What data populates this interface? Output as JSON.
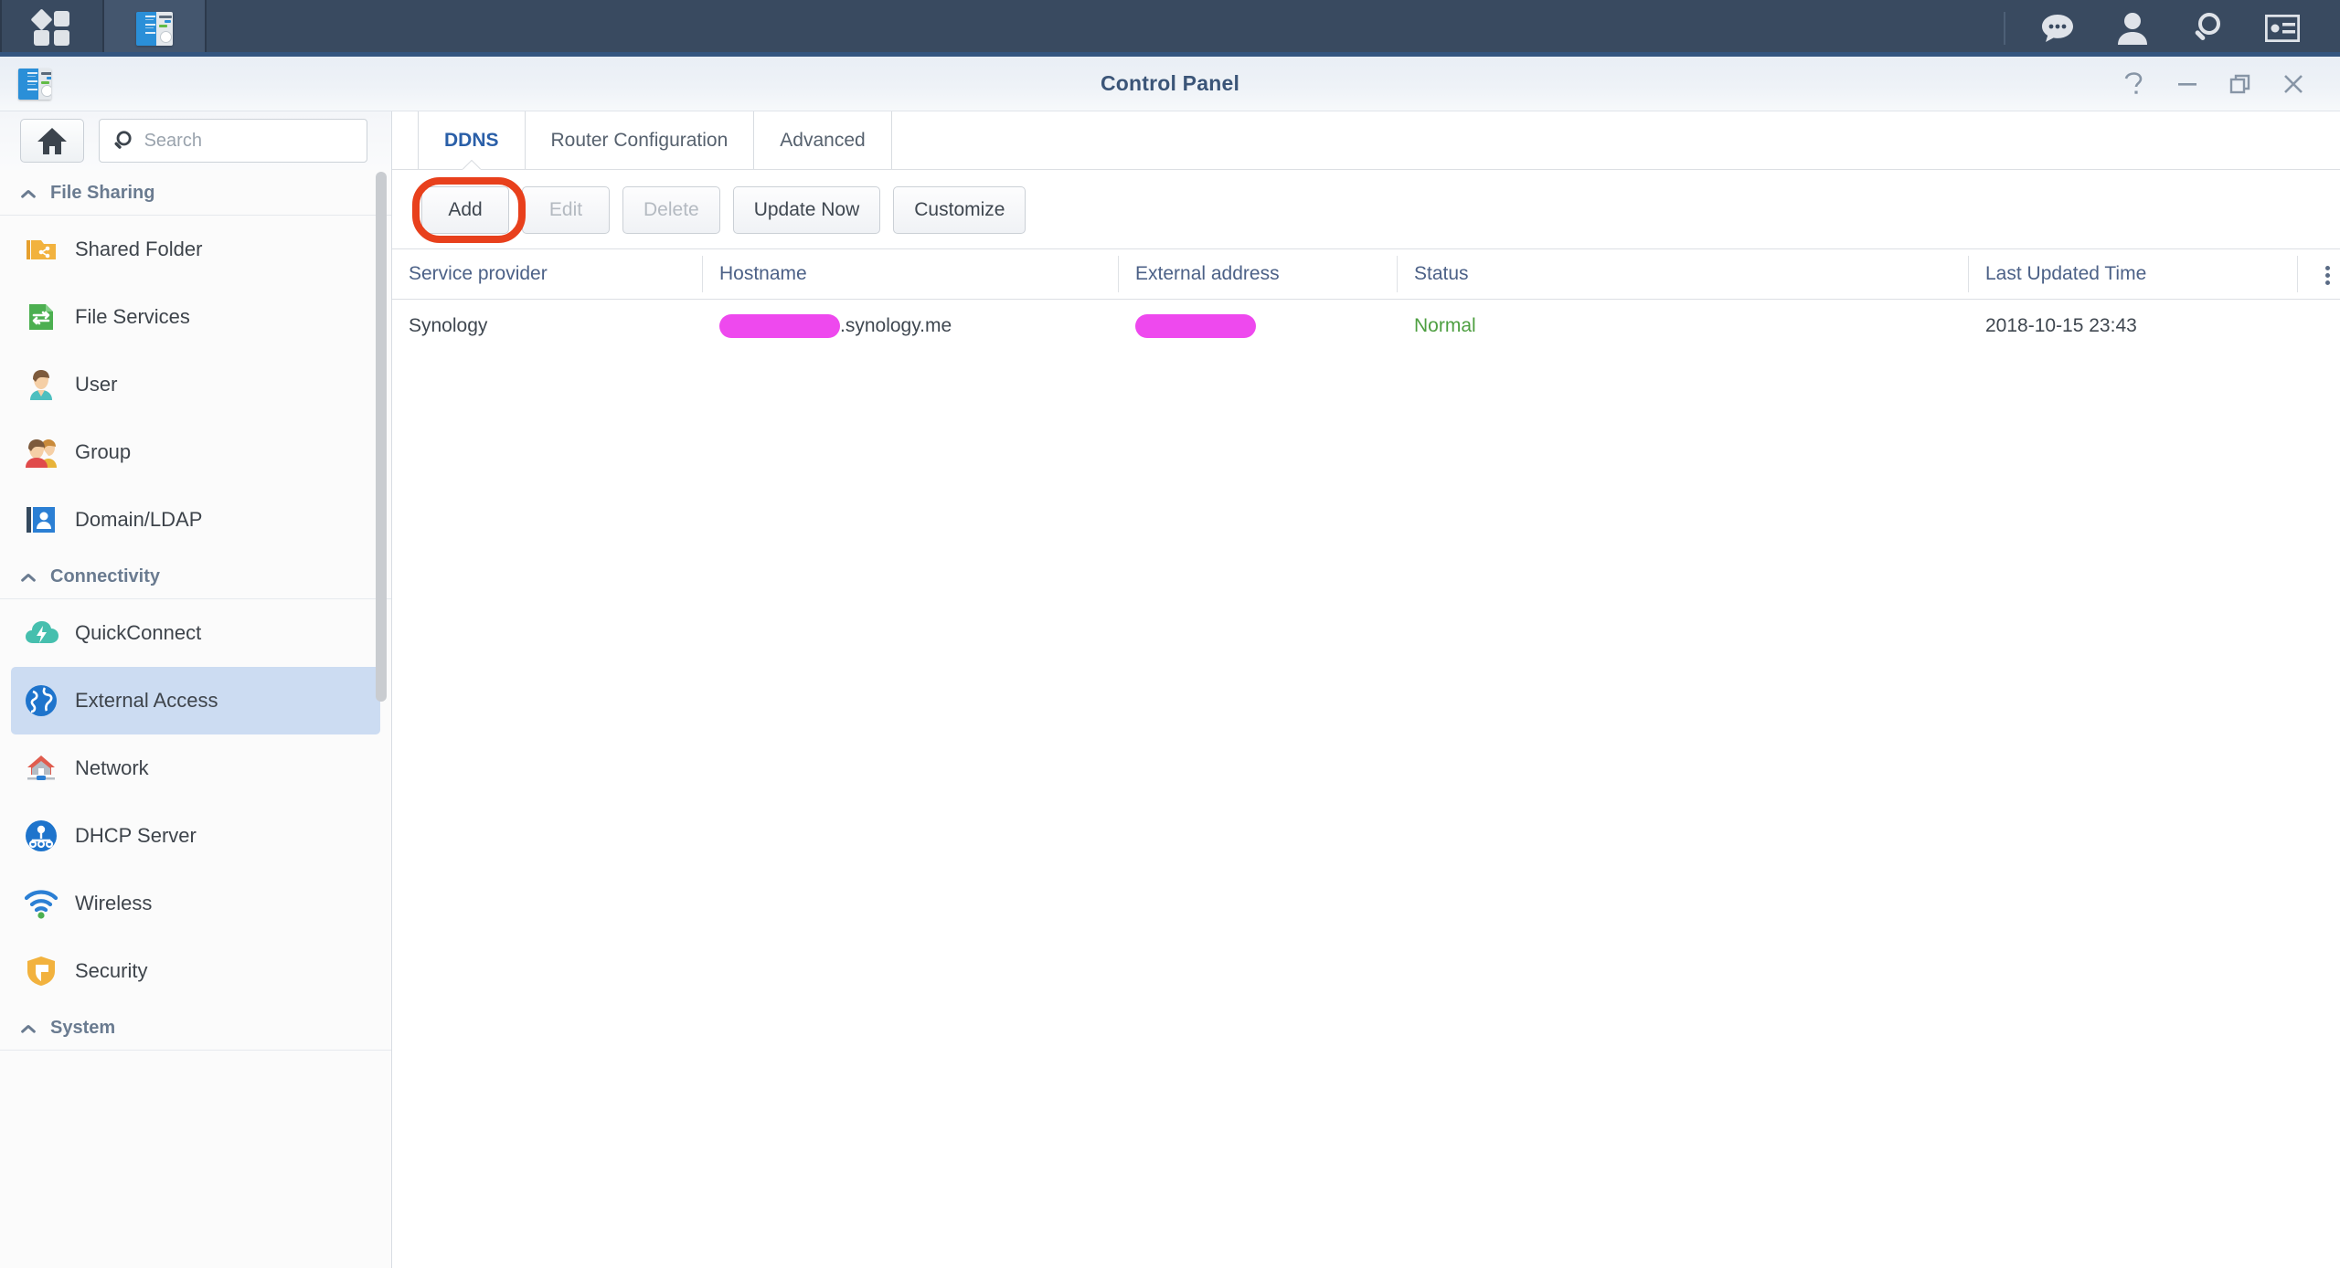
{
  "taskbar": {
    "app_menu_icon": "app-grid-icon",
    "open_apps": [
      {
        "name": "Control Panel",
        "icon": "control-panel-icon",
        "active": true
      }
    ],
    "tray_icons": [
      {
        "name": "notifications-icon",
        "glyph": "chat-bubble"
      },
      {
        "name": "user-account-icon",
        "glyph": "person"
      },
      {
        "name": "search-icon",
        "glyph": "magnifier"
      },
      {
        "name": "widgets-icon",
        "glyph": "contact-card"
      }
    ]
  },
  "window": {
    "title": "Control Panel",
    "icon": "control-panel-icon",
    "controls": [
      {
        "name": "help-button",
        "glyph": "?"
      },
      {
        "name": "minimize-button",
        "glyph": "—"
      },
      {
        "name": "restore-button",
        "glyph": "❐"
      },
      {
        "name": "close-button",
        "glyph": "✕"
      }
    ]
  },
  "sidebar": {
    "home_button": "home-icon",
    "search": {
      "placeholder": "Search",
      "value": ""
    },
    "sections": [
      {
        "title": "File Sharing",
        "collapsed": false,
        "items": [
          {
            "label": "Shared Folder",
            "icon": "shared-folder-icon",
            "selected": false
          },
          {
            "label": "File Services",
            "icon": "file-services-icon",
            "selected": false
          },
          {
            "label": "User",
            "icon": "user-icon",
            "selected": false
          },
          {
            "label": "Group",
            "icon": "group-icon",
            "selected": false
          },
          {
            "label": "Domain/LDAP",
            "icon": "domain-ldap-icon",
            "selected": false
          }
        ]
      },
      {
        "title": "Connectivity",
        "collapsed": false,
        "items": [
          {
            "label": "QuickConnect",
            "icon": "quickconnect-icon",
            "selected": false
          },
          {
            "label": "External Access",
            "icon": "external-access-icon",
            "selected": true
          },
          {
            "label": "Network",
            "icon": "network-icon",
            "selected": false
          },
          {
            "label": "DHCP Server",
            "icon": "dhcp-server-icon",
            "selected": false
          },
          {
            "label": "Wireless",
            "icon": "wireless-icon",
            "selected": false
          },
          {
            "label": "Security",
            "icon": "security-icon",
            "selected": false
          }
        ]
      },
      {
        "title": "System",
        "collapsed": false,
        "items": []
      }
    ]
  },
  "main": {
    "tabs": [
      {
        "label": "DDNS",
        "active": true
      },
      {
        "label": "Router Configuration",
        "active": false
      },
      {
        "label": "Advanced",
        "active": false
      }
    ],
    "toolbar": [
      {
        "label": "Add",
        "disabled": false,
        "highlighted": true
      },
      {
        "label": "Edit",
        "disabled": true,
        "highlighted": false
      },
      {
        "label": "Delete",
        "disabled": true,
        "highlighted": false
      },
      {
        "label": "Update Now",
        "disabled": false,
        "highlighted": false
      },
      {
        "label": "Customize",
        "disabled": false,
        "highlighted": false
      }
    ],
    "table": {
      "columns": [
        "Service provider",
        "Hostname",
        "External address",
        "Status",
        "Last Updated Time"
      ],
      "rows": [
        {
          "service_provider": "Synology",
          "hostname_redacted_width": 130,
          "hostname_suffix": ".synology.me",
          "external_address_redacted_width": 130,
          "status": "Normal",
          "last_updated_time": "2018-10-15 23:43"
        }
      ],
      "column_menu_icon": "kebab-menu-icon"
    }
  },
  "colors": {
    "accent": "#2a5fa8",
    "highlight_ring": "#e8401c",
    "redaction": "#ee49ee",
    "status_ok": "#4e9f41",
    "selection": "#ccdcf2",
    "taskbar": "#394a60"
  }
}
